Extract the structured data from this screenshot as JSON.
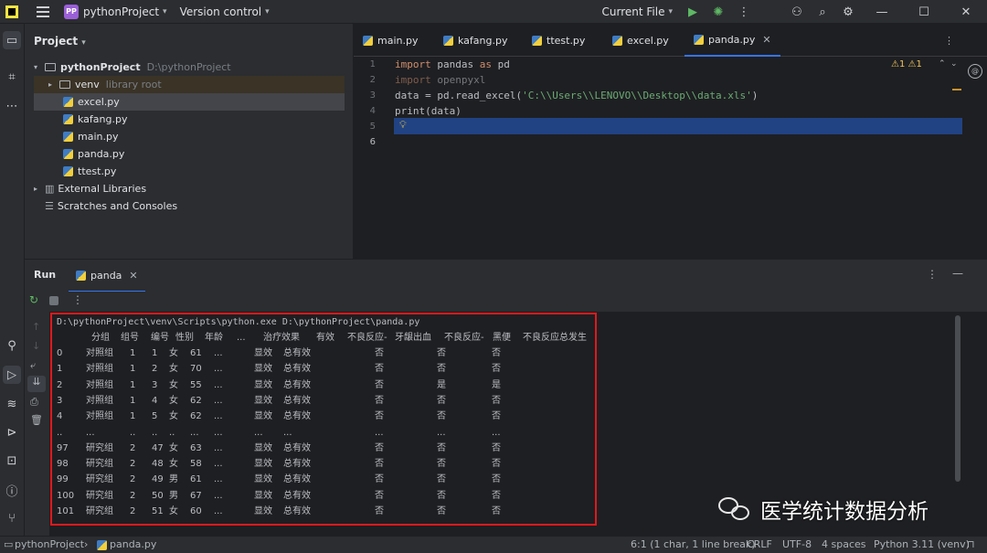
{
  "titlebar": {
    "project_badge": "PP",
    "project_name": "pythonProject",
    "vcs": "Version control",
    "run_config": "Current File"
  },
  "project_panel": {
    "title": "Project",
    "root": "pythonProject",
    "root_path": "D:\\pythonProject",
    "venv": "venv",
    "venv_hint": "library root",
    "files": [
      "excel.py",
      "kafang.py",
      "main.py",
      "panda.py",
      "ttest.py"
    ],
    "external": "External Libraries",
    "scratches": "Scratches and Consoles"
  },
  "tabs": [
    "main.py",
    "kafang.py",
    "ttest.py",
    "excel.py",
    "panda.py"
  ],
  "editor": {
    "line_numbers": [
      "1",
      "2",
      "3",
      "4",
      "5",
      "6"
    ],
    "inspections": "⚠1 ⚠1",
    "line1": {
      "kw1": "import",
      "mod": "pandas",
      "kw2": "as",
      "alias": "pd"
    },
    "line2": {
      "kw": "import",
      "mod": "openpyxl"
    },
    "line3": {
      "pre": "data = pd.read_excel(",
      "str": "'C:\\\\Users\\\\LENOVO\\\\Desktop\\\\data.xls'",
      "post": ")"
    },
    "line4": "print(data)"
  },
  "run": {
    "title": "Run",
    "tab": "panda"
  },
  "console": {
    "command": "D:\\pythonProject\\venv\\Scripts\\python.exe D:\\pythonProject\\panda.py",
    "header": [
      "分组",
      "组号",
      "编号",
      "性别",
      "年龄",
      "...",
      "治疗效果",
      "有效",
      "不良反应-",
      "牙龈出血",
      "不良反应-",
      "黑便",
      "不良反应总发生"
    ],
    "rows": [
      [
        "0",
        "对照组",
        "1",
        "1",
        "女",
        "61",
        "...",
        "显效",
        "总有效",
        "否",
        "否",
        "否"
      ],
      [
        "1",
        "对照组",
        "1",
        "2",
        "女",
        "70",
        "...",
        "显效",
        "总有效",
        "否",
        "否",
        "否"
      ],
      [
        "2",
        "对照组",
        "1",
        "3",
        "女",
        "55",
        "...",
        "显效",
        "总有效",
        "否",
        "是",
        "是"
      ],
      [
        "3",
        "对照组",
        "1",
        "4",
        "女",
        "62",
        "...",
        "显效",
        "总有效",
        "否",
        "否",
        "否"
      ],
      [
        "4",
        "对照组",
        "1",
        "5",
        "女",
        "62",
        "...",
        "显效",
        "总有效",
        "否",
        "否",
        "否"
      ],
      [
        "..",
        "...",
        "..",
        "..",
        "..",
        "...",
        "...",
        "...",
        "...",
        "...",
        "...",
        "..."
      ],
      [
        "97",
        "研究组",
        "2",
        "47",
        "女",
        "63",
        "...",
        "显效",
        "总有效",
        "否",
        "否",
        "否"
      ],
      [
        "98",
        "研究组",
        "2",
        "48",
        "女",
        "58",
        "...",
        "显效",
        "总有效",
        "否",
        "否",
        "否"
      ],
      [
        "99",
        "研究组",
        "2",
        "49",
        "男",
        "61",
        "...",
        "显效",
        "总有效",
        "否",
        "否",
        "否"
      ],
      [
        "100",
        "研究组",
        "2",
        "50",
        "男",
        "67",
        "...",
        "显效",
        "总有效",
        "否",
        "否",
        "否"
      ],
      [
        "101",
        "研究组",
        "2",
        "51",
        "女",
        "60",
        "...",
        "显效",
        "总有效",
        "否",
        "否",
        "否"
      ]
    ]
  },
  "watermark": "医学统计数据分析",
  "statusbar": {
    "project": "pythonProject",
    "file": "panda.py",
    "position": "6:1 (1 char, 1 line break)",
    "line_sep": "CRLF",
    "encoding": "UTF-8",
    "indent": "4 spaces",
    "interpreter": "Python 3.11 (venv)"
  },
  "colors": {
    "highlight": "#214283",
    "keyword": "#cf8e6d",
    "string": "#6aab73",
    "annotation_box": "#e0191c"
  }
}
